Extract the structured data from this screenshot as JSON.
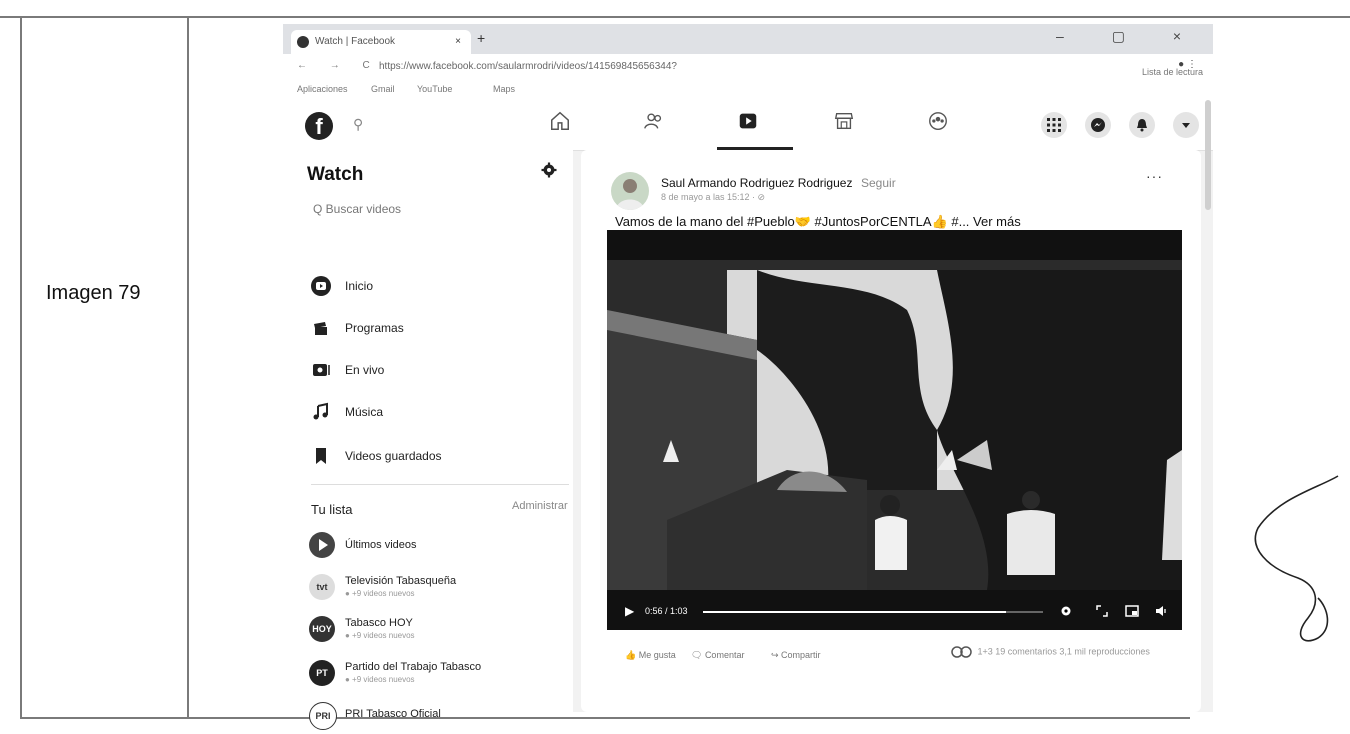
{
  "label": "Imagen 79",
  "browser": {
    "tab_title": "Watch | Facebook",
    "tab_close": "×",
    "new_tab": "+",
    "window_controls": "– ▢ ×",
    "nav_icons": "← → C",
    "url": "https://www.facebook.com/saularmrodri/videos/141569845656344?",
    "reading_list": "Lista de lectura",
    "bookmarks": [
      "Aplicaciones",
      "Gmail",
      "YouTube",
      "Maps"
    ]
  },
  "fb": {
    "logo": "f",
    "search_icon": "search-icon"
  },
  "sidebar": {
    "title": "Watch",
    "search_placeholder": "Q Buscar videos",
    "menu": [
      {
        "label": "Inicio",
        "icon": "watch-play-icon"
      },
      {
        "label": "Programas",
        "icon": "shows-icon"
      },
      {
        "label": "En vivo",
        "icon": "live-icon"
      },
      {
        "label": "Música",
        "icon": "music-note-icon"
      },
      {
        "label": "Videos guardados",
        "icon": "bookmark-icon"
      }
    ],
    "list_title": "Tu lista",
    "manage": "Administrar",
    "subscriptions": [
      {
        "name": "Últimos videos",
        "meta": "",
        "avatar": ""
      },
      {
        "name": "Televisión Tabasqueña",
        "meta": "● +9 videos nuevos",
        "avatar": "tvt"
      },
      {
        "name": "Tabasco HOY",
        "meta": "● +9 videos nuevos",
        "avatar": "HOY"
      },
      {
        "name": "Partido del Trabajo Tabasco",
        "meta": "● +9 videos nuevos",
        "avatar": "PT"
      },
      {
        "name": "PRI Tabasco Oficial",
        "meta": "",
        "avatar": "PRI"
      }
    ]
  },
  "post": {
    "author": "Saul Armando Rodriguez Rodriguez",
    "follow": "Seguir",
    "time": "8 de mayo a las 15:12 · ⊘",
    "more": "···",
    "text": "Vamos de la mano del #Pueblo🤝 #JuntosPorCENTLA👍 #... Ver más",
    "video": {
      "time": "0:56 / 1:03",
      "progress": 0.89
    },
    "actions": {
      "like": "Me gusta",
      "comment": "Comentar",
      "share": "Compartir"
    },
    "stats": "1+3   19 comentarios   3,1 mil reproducciones"
  }
}
